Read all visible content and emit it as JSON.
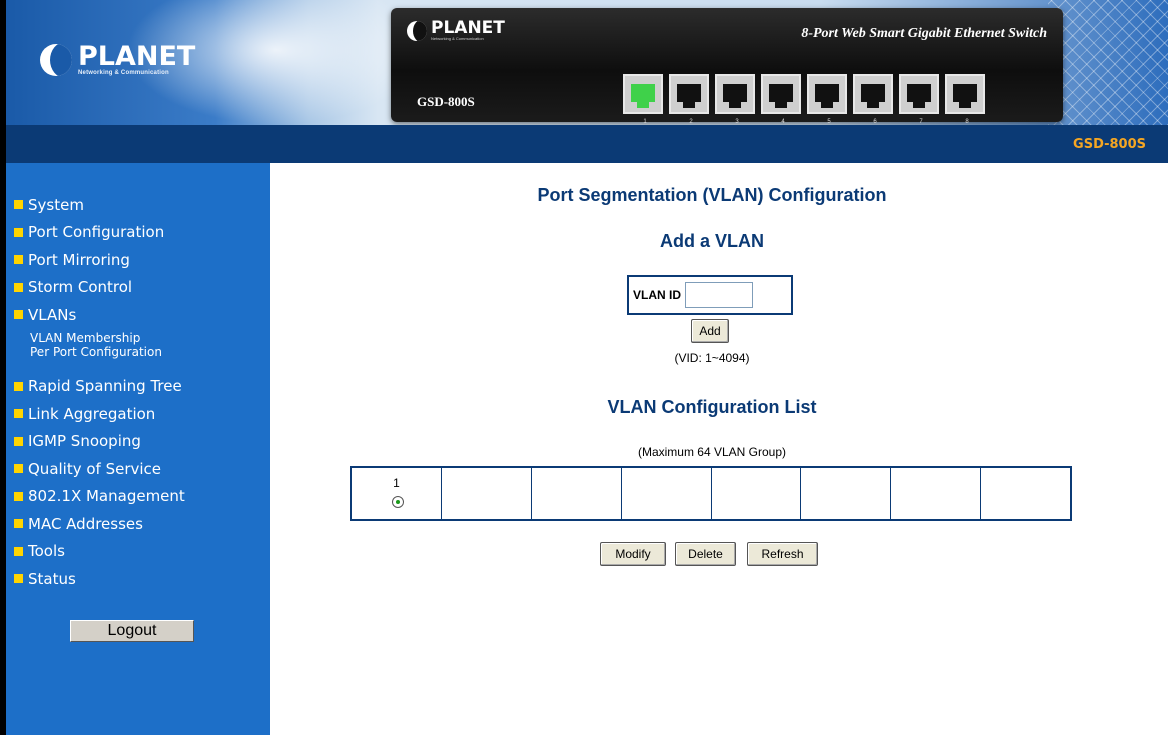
{
  "header": {
    "brand": "PLANET",
    "brand_tagline": "Networking & Communication",
    "device_title": "8-Port Web Smart Gigabit Ethernet Switch",
    "device_model": "GSD-800S",
    "ports": [
      "1",
      "2",
      "3",
      "4",
      "5",
      "6",
      "7",
      "8"
    ]
  },
  "band": {
    "model": "GSD-800S"
  },
  "sidebar": {
    "items": [
      {
        "label": "System"
      },
      {
        "label": "Port Configuration"
      },
      {
        "label": "Port Mirroring"
      },
      {
        "label": "Storm Control"
      },
      {
        "label": "VLANs"
      },
      {
        "label": "Rapid Spanning Tree"
      },
      {
        "label": "Link Aggregation"
      },
      {
        "label": "IGMP Snooping"
      },
      {
        "label": "Quality of Service"
      },
      {
        "label": "802.1X Management"
      },
      {
        "label": "MAC Addresses"
      },
      {
        "label": "Tools"
      },
      {
        "label": "Status"
      }
    ],
    "vlan_subitems": [
      "VLAN Membership",
      "Per Port Configuration"
    ],
    "logout_label": "Logout"
  },
  "main": {
    "page_title": "Port Segmentation (VLAN) Configuration",
    "add_title": "Add a VLAN",
    "vlan_id_label": "VLAN ID",
    "vlan_id_value": "",
    "add_button": "Add",
    "vid_hint": "(VID: 1~4094)",
    "list_title": "VLAN Configuration List",
    "max_hint": "(Maximum 64 VLAN Group)",
    "vlan_list": [
      "1",
      "",
      "",
      "",
      "",
      "",
      "",
      ""
    ],
    "selected_vlan": "1",
    "modify_button": "Modify",
    "delete_button": "Delete",
    "refresh_button": "Refresh"
  },
  "colors": {
    "nav_bg": "#1d6fc8",
    "band_bg": "#0b3a75",
    "accent_model": "#f5a623",
    "bullet": "#ffd400",
    "title_text": "#0b3a75"
  }
}
